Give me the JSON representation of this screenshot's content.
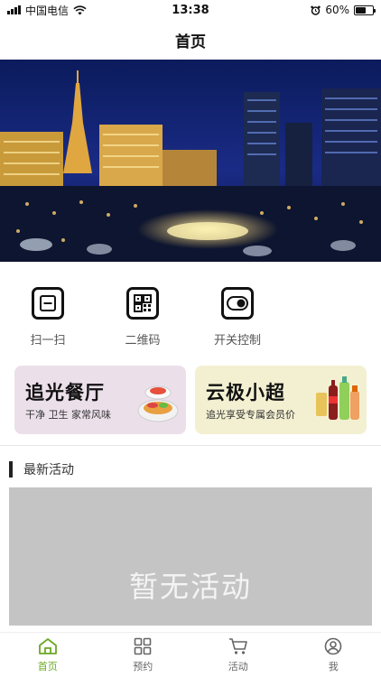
{
  "status_bar": {
    "carrier": "中国电信",
    "time": "13:38",
    "battery_percent": "60%",
    "battery_level": 0.6,
    "icons": [
      "signal-icon",
      "wifi-icon",
      "alarm-icon",
      "battery-icon"
    ]
  },
  "nav": {
    "title": "首页"
  },
  "banner": {
    "image": "city-night-skyline"
  },
  "quick_actions": [
    {
      "label": "扫一扫",
      "icon": "scan-icon"
    },
    {
      "label": "二维码",
      "icon": "qrcode-icon"
    },
    {
      "label": "开关控制",
      "icon": "toggle-icon"
    }
  ],
  "promos": [
    {
      "title": "追光餐厅",
      "subtitle": "干净 卫生 家常风味",
      "bg_color": "#ebe0ea",
      "icon": "food-plate-icon"
    },
    {
      "title": "云极小超",
      "subtitle": "追光享受专属会员价",
      "bg_color": "#f3f0d2",
      "icon": "drinks-icon"
    }
  ],
  "section": {
    "title": "最新活动"
  },
  "empty_state": {
    "text": "暂无活动"
  },
  "tab_bar": {
    "items": [
      {
        "label": "首页",
        "icon": "home-icon",
        "active": true
      },
      {
        "label": "预约",
        "icon": "grid-icon",
        "active": false
      },
      {
        "label": "活动",
        "icon": "cart-icon",
        "active": false
      },
      {
        "label": "我",
        "icon": "user-icon",
        "active": false
      }
    ],
    "active_color": "#6ba823"
  }
}
